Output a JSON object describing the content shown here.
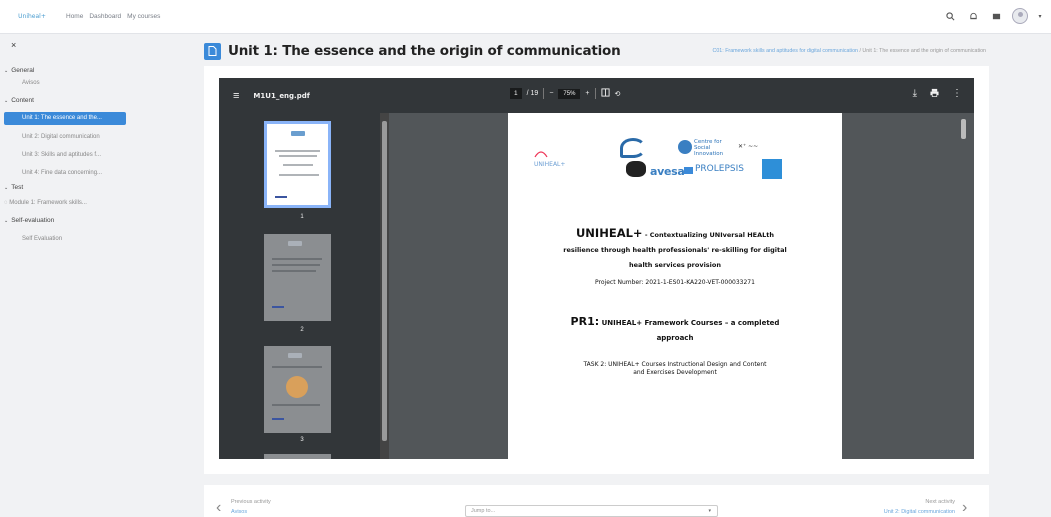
{
  "topbar": {
    "logo_text": "Uniheal+",
    "nav": [
      "Home",
      "Dashboard",
      "My courses"
    ]
  },
  "sidebar": {
    "close": "×",
    "sections": [
      {
        "label": "General",
        "items": [
          "Avisos"
        ]
      },
      {
        "label": "Content",
        "items": [
          "Unit 1: The essence and the...",
          "Unit 2: Digital communication",
          "Unit 3: Skills and aptitudes f...",
          "Unit 4: Fine data concerning..."
        ]
      },
      {
        "label": "Test",
        "items": [
          "Module 1: Framework skills..."
        ]
      },
      {
        "label": "Self-evaluation",
        "items": [
          "Self Evaluation"
        ]
      }
    ]
  },
  "page": {
    "title": "Unit 1: The essence and the origin of communication",
    "breadcrumb_link": "C01: Framework skills and aptitudes for digital communication",
    "breadcrumb_sep": "/",
    "breadcrumb_current": "Unit 1: The essence and the origin of communication"
  },
  "pdf": {
    "filename": "M1U1_eng.pdf",
    "page_current": "1",
    "page_total": "/ 19",
    "zoom": "75%",
    "thumb_numbers": [
      "1",
      "2",
      "3"
    ]
  },
  "document": {
    "logo_uniheal": "UNIHEAL+",
    "logo_social": "Centre for Social Innovation",
    "logo_avesa": "avesa",
    "logo_prolepsis": "PROLEPSIS",
    "title_bold": "UNIHEAL+",
    "title_rest": " - Contextualizing UNIversal HEALth resilience through health professionals' re-skilling for digital health services provision",
    "project_number": "Project Number:  2021-1-ES01-KA220-VET-000033271",
    "pr_bold": "PR1:",
    "pr_rest": " UNIHEAL+ Framework Courses – a completed approach",
    "task": "TASK 2: UNIHEAL+ Courses Instructional Design and Content and Exercises Development"
  },
  "footer": {
    "prev_label": "Previous activity",
    "prev_link": "Avisos",
    "jump_placeholder": "Jump to...",
    "next_label": "Next activity",
    "next_link": "Unit 2: Digital communication"
  },
  "colors": {
    "accent": "#3b8ad9",
    "pdf_toolbar": "#323639",
    "viewer_bg": "#525659"
  }
}
